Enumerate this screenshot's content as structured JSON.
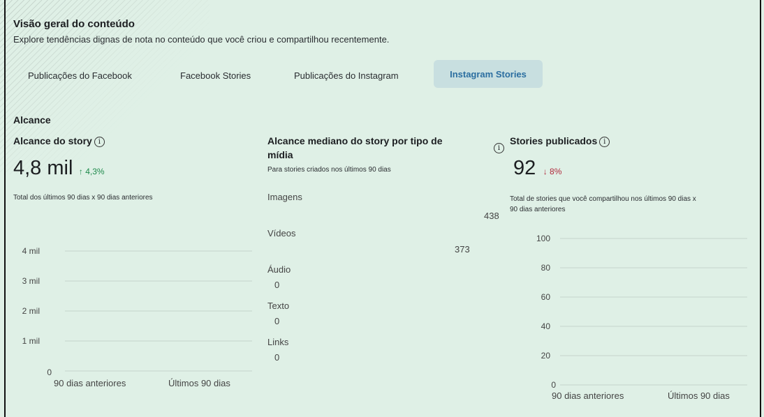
{
  "header": {
    "title": "Visão geral do conteúdo",
    "subtitle": "Explore tendências dignas de nota no conteúdo que você criou e compartilhou recentemente."
  },
  "tabs": [
    {
      "label": "Publicações do Facebook",
      "active": false
    },
    {
      "label": "Facebook Stories",
      "active": false
    },
    {
      "label": "Publicações do Instagram",
      "active": false
    },
    {
      "label": "Instagram Stories",
      "active": true
    }
  ],
  "section_title": "Alcance",
  "reach": {
    "title": "Alcance do story",
    "value": "4,8 mil",
    "change": "↑ 4,3%",
    "caption": "Total dos últimos 90 dias x 90 dias anteriores",
    "chart": {
      "y_ticks": [
        "4 mil",
        "3 mil",
        "2 mil",
        "1 mil",
        "0"
      ],
      "x_labels": [
        "90 dias anteriores",
        "Últimos 90 dias"
      ]
    }
  },
  "median": {
    "title_line1": "Alcance mediano do story por tipo de",
    "title_line2": "mídia",
    "caption": "Para stories criados nos últimos 90 dias",
    "rows": [
      {
        "label": "Imagens",
        "value": "438"
      },
      {
        "label": "Vídeos",
        "value": "373"
      },
      {
        "label": "Áudio",
        "value": "0"
      },
      {
        "label": "Texto",
        "value": "0"
      },
      {
        "label": "Links",
        "value": "0"
      }
    ]
  },
  "published": {
    "title": "Stories publicados",
    "value": "92",
    "change": "↓ 8%",
    "caption_line1": "Total de stories que você compartilhou nos últimos 90 dias x",
    "caption_line2": "90 dias anteriores",
    "chart": {
      "y_ticks": [
        "100",
        "80",
        "60",
        "40",
        "20",
        "0"
      ],
      "x_labels": [
        "90 dias anteriores",
        "Últimos 90 dias"
      ]
    }
  },
  "info_glyph": "i",
  "colors": {
    "accent": "#2b6ea0",
    "up": "#1f8a4c",
    "down": "#b0283b",
    "tab_active_bg": "#c8dfe0"
  }
}
